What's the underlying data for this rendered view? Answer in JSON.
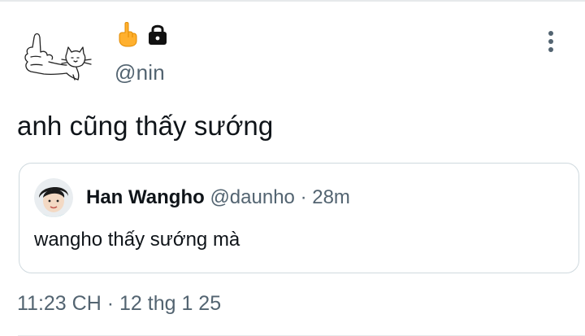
{
  "author": {
    "handle": "@nin"
  },
  "menu": {
    "more_icon": "more-vertical-icon"
  },
  "tweet": {
    "text": "anh cũng thấy sướng"
  },
  "quoted_tweet": {
    "name": "Han Wangho",
    "handle": "@daunho",
    "separator": "·",
    "time": "28m",
    "text": "wangho thấy sướng mà"
  },
  "meta": {
    "time": "11:23 CH",
    "separator": "·",
    "date": "12 thg 1 25"
  },
  "colors": {
    "secondary_text": "#536471",
    "primary_text": "#0f1419",
    "border": "#cfd9de"
  }
}
